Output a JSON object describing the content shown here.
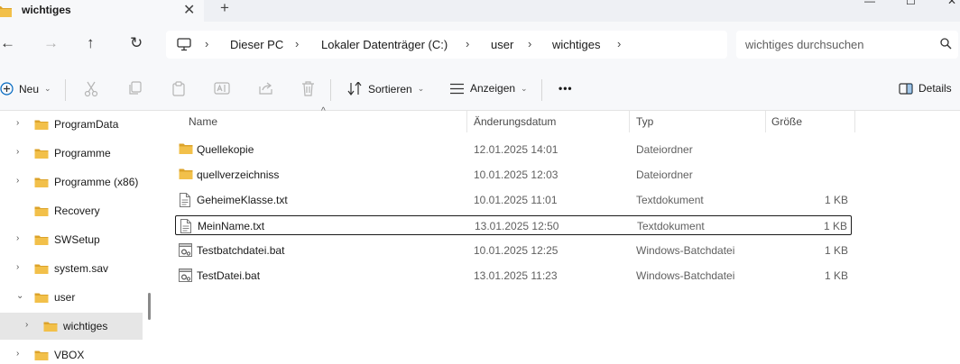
{
  "tab": {
    "title": "wichtiges",
    "close_glyph": "✕",
    "new_tab_glyph": "+"
  },
  "window_controls": {
    "minimize": "—",
    "maximize": "☐",
    "close": "✕"
  },
  "nav": {
    "back": "←",
    "forward": "→",
    "up": "↑",
    "refresh": "↻"
  },
  "breadcrumb": [
    "Dieser PC",
    "Lokaler Datenträger (C:)",
    "user",
    "wichtiges"
  ],
  "breadcrumb_separator": "›",
  "search": {
    "placeholder": "wichtiges durchsuchen"
  },
  "toolbar": {
    "new_label": "Neu",
    "sort_label": "Sortieren",
    "view_label": "Anzeigen",
    "more_label": "•••",
    "details_label": "Details",
    "caret": "⌄"
  },
  "sidebar": {
    "items": [
      {
        "label": "ProgramData",
        "expander": "›"
      },
      {
        "label": "Programme",
        "expander": "›"
      },
      {
        "label": "Programme (x86)",
        "expander": "›"
      },
      {
        "label": "Recovery",
        "expander": ""
      },
      {
        "label": "SWSetup",
        "expander": "›"
      },
      {
        "label": "system.sav",
        "expander": "›"
      },
      {
        "label": "user",
        "expander": "⌄"
      },
      {
        "label": "wichtiges",
        "expander": "›",
        "selected": true
      },
      {
        "label": "VBOX",
        "expander": "›"
      }
    ]
  },
  "columns": {
    "name": "Name",
    "date": "Änderungsdatum",
    "type": "Typ",
    "size": "Größe",
    "sort_indicator": "^"
  },
  "files": [
    {
      "name": "Quellekopie",
      "date": "12.01.2025 14:01",
      "type": "Dateiordner",
      "size": "",
      "icon": "folder-icon"
    },
    {
      "name": "quellverzeichniss",
      "date": "10.01.2025 12:03",
      "type": "Dateiordner",
      "size": "",
      "icon": "folder-icon"
    },
    {
      "name": "GeheimeKlasse.txt",
      "date": "10.01.2025 11:01",
      "type": "Textdokument",
      "size": "1 KB",
      "icon": "text-file-icon"
    },
    {
      "name": "MeinName.txt",
      "date": "13.01.2025 12:50",
      "type": "Textdokument",
      "size": "1 KB",
      "icon": "text-file-icon",
      "focused": true
    },
    {
      "name": "Testbatchdatei.bat",
      "date": "10.01.2025 12:25",
      "type": "Windows-Batchdatei",
      "size": "1 KB",
      "icon": "batch-file-icon"
    },
    {
      "name": "TestDatei.bat",
      "date": "13.01.2025 11:23",
      "type": "Windows-Batchdatei",
      "size": "1 KB",
      "icon": "batch-file-icon"
    }
  ],
  "colors": {
    "folder": "#f2c04a",
    "folder_dark": "#dca32a",
    "selected_bg": "#e6e6e6",
    "chrome_bg": "#f7f8fa",
    "accent": "#0067c0"
  }
}
